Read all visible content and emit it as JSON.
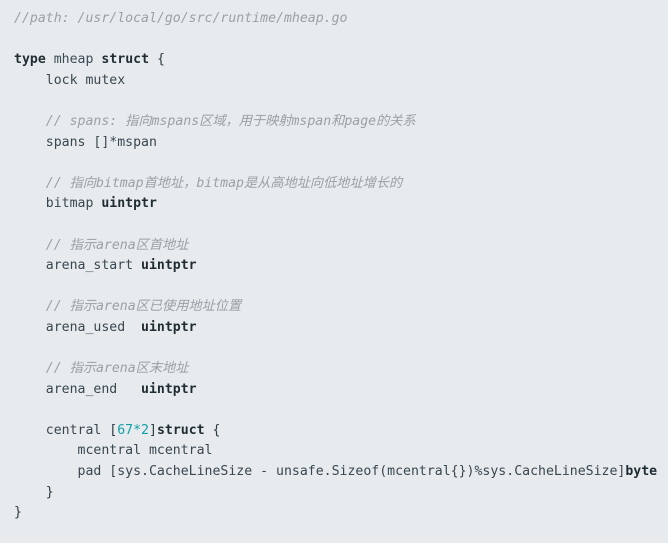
{
  "editor": {
    "language": "go",
    "background_color": "#e8ebee",
    "default_text_color": "#2b3a42",
    "comment_color": "#9aa0a6",
    "number_color": "#11a0a8",
    "keyword_color": "#1f2d33",
    "file_path_comment": "//path: /usr/local/go/src/runtime/mheap.go"
  },
  "lines": [
    {
      "id": "line-1",
      "type": "comment",
      "text": "//path: /usr/local/go/src/runtime/mheap.go"
    },
    {
      "id": "line-2",
      "type": "blank",
      "text": ""
    },
    {
      "id": "line-3",
      "type": "code",
      "indent": 0,
      "tokens": [
        {
          "cls": "tok-kw",
          "text": "type"
        },
        {
          "cls": "tok-plain",
          "text": " "
        },
        {
          "cls": "tok-ident",
          "text": "mheap"
        },
        {
          "cls": "tok-plain",
          "text": " "
        },
        {
          "cls": "tok-kw",
          "text": "struct"
        },
        {
          "cls": "tok-punct",
          "text": " {"
        }
      ],
      "text": "type mheap struct {"
    },
    {
      "id": "line-4",
      "type": "code",
      "indent": 1,
      "tokens": [
        {
          "cls": "tok-plain",
          "text": "    lock mutex"
        }
      ],
      "text": "    lock mutex"
    },
    {
      "id": "line-5",
      "type": "blank",
      "text": ""
    },
    {
      "id": "line-6",
      "type": "comment",
      "indent": 1,
      "text": "    // spans: 指向mspans区域，用于映射mspan和page的关系"
    },
    {
      "id": "line-7",
      "type": "code",
      "indent": 1,
      "tokens": [
        {
          "cls": "tok-plain",
          "text": "    spans []*mspan"
        }
      ],
      "text": "    spans []*mspan"
    },
    {
      "id": "line-8",
      "type": "blank",
      "text": ""
    },
    {
      "id": "line-9",
      "type": "comment",
      "indent": 1,
      "text": "    // 指向bitmap首地址，bitmap是从高地址向低地址增长的"
    },
    {
      "id": "line-10",
      "type": "code",
      "indent": 1,
      "tokens": [
        {
          "cls": "tok-plain",
          "text": "    bitmap "
        },
        {
          "cls": "tok-type",
          "text": "uintptr"
        }
      ],
      "text": "    bitmap uintptr"
    },
    {
      "id": "line-11",
      "type": "blank",
      "text": ""
    },
    {
      "id": "line-12",
      "type": "comment",
      "indent": 1,
      "text": "    // 指示arena区首地址"
    },
    {
      "id": "line-13",
      "type": "code",
      "indent": 1,
      "tokens": [
        {
          "cls": "tok-plain",
          "text": "    arena_start "
        },
        {
          "cls": "tok-type",
          "text": "uintptr"
        }
      ],
      "text": "    arena_start uintptr"
    },
    {
      "id": "line-14",
      "type": "blank",
      "text": ""
    },
    {
      "id": "line-15",
      "type": "comment",
      "indent": 1,
      "text": "    // 指示arena区已使用地址位置"
    },
    {
      "id": "line-16",
      "type": "code",
      "indent": 1,
      "tokens": [
        {
          "cls": "tok-plain",
          "text": "    arena_used  "
        },
        {
          "cls": "tok-type",
          "text": "uintptr"
        }
      ],
      "text": "    arena_used  uintptr"
    },
    {
      "id": "line-17",
      "type": "blank",
      "text": ""
    },
    {
      "id": "line-18",
      "type": "comment",
      "indent": 1,
      "text": "    // 指示arena区末地址"
    },
    {
      "id": "line-19",
      "type": "code",
      "indent": 1,
      "tokens": [
        {
          "cls": "tok-plain",
          "text": "    arena_end   "
        },
        {
          "cls": "tok-type",
          "text": "uintptr"
        }
      ],
      "text": "    arena_end   uintptr"
    },
    {
      "id": "line-20",
      "type": "blank",
      "text": ""
    },
    {
      "id": "line-21",
      "type": "code",
      "indent": 1,
      "tokens": [
        {
          "cls": "tok-plain",
          "text": "    central "
        },
        {
          "cls": "tok-punct",
          "text": "["
        },
        {
          "cls": "tok-num",
          "text": "67*2"
        },
        {
          "cls": "tok-punct",
          "text": "]"
        },
        {
          "cls": "tok-kw",
          "text": "struct"
        },
        {
          "cls": "tok-punct",
          "text": " {"
        }
      ],
      "text": "    central [67*2]struct {"
    },
    {
      "id": "line-22",
      "type": "code",
      "indent": 2,
      "tokens": [
        {
          "cls": "tok-plain",
          "text": "        mcentral mcentral"
        }
      ],
      "text": "        mcentral mcentral"
    },
    {
      "id": "line-23",
      "type": "code",
      "indent": 2,
      "tokens": [
        {
          "cls": "tok-plain",
          "text": "        pad [sys.CacheLineSize - unsafe.Sizeof(mcentral{})%sys.CacheLineSize]"
        },
        {
          "cls": "tok-type",
          "text": "byte"
        }
      ],
      "text": "        pad [sys.CacheLineSize - unsafe.Sizeof(mcentral{})%sys.CacheLineSize]byte"
    },
    {
      "id": "line-24",
      "type": "code",
      "indent": 1,
      "tokens": [
        {
          "cls": "tok-punct",
          "text": "    }"
        }
      ],
      "text": "    }"
    },
    {
      "id": "line-25",
      "type": "code",
      "indent": 0,
      "tokens": [
        {
          "cls": "tok-punct",
          "text": "}"
        }
      ],
      "text": "}"
    }
  ]
}
